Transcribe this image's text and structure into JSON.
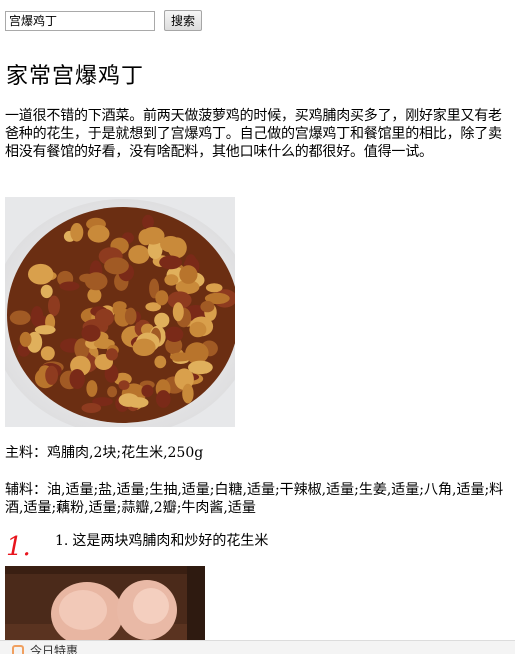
{
  "search": {
    "value": "宫爆鸡丁",
    "button_label": "搜索"
  },
  "recipe": {
    "title": "家常宫爆鸡丁",
    "intro": "一道很不错的下酒菜。前两天做菠萝鸡的时候，买鸡脯肉买多了，刚好家里又有老爸种的花生，于是就想到了宫爆鸡丁。自己做的宫爆鸡丁和餐馆里的相比，除了卖相没有餐馆的好看，没有啥配料，其他口味什么的都很好。值得一试。",
    "main_ingredients": "主料：鸡脯肉,2块;花生米,250g",
    "aux_ingredients": "辅料：油,适量;盐,适量;生抽,适量;白糖,适量;干辣椒,适量;生姜,适量;八角,适量;料酒,适量;藕粉,适量;蒜瓣,2瓣;牛肉酱,适量"
  },
  "steps": [
    {
      "badge": "1.",
      "number": "1.",
      "text": "这是两块鸡脯肉和炒好的花生米"
    }
  ],
  "bottom_bar": {
    "icon": "flame-icon",
    "label": "今日特惠"
  },
  "images": {
    "main_photo": "kung-pao-chicken-plate",
    "step_photo": "raw-chicken-breast"
  }
}
